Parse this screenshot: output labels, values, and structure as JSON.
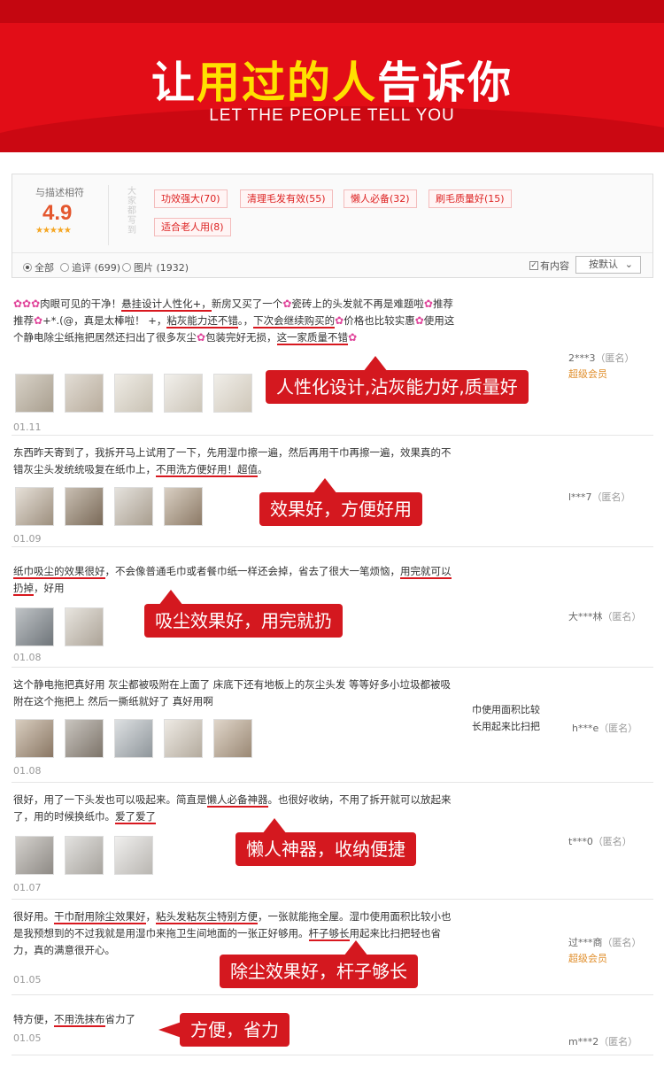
{
  "banner": {
    "title_pre": "让",
    "title_highlight": "用过的人",
    "title_post": "告诉你",
    "subtitle": "LET THE PEOPLE TELL YOU"
  },
  "summary": {
    "score_label": "与描述相符",
    "score": "4.9",
    "stars": "★★★★★",
    "impression_label": "大家都写到",
    "tags": [
      "功效强大(70)",
      "清理毛发有效(55)",
      "懒人必备(32)",
      "刷毛质量好(15)",
      "适合老人用(8)"
    ]
  },
  "filter": {
    "options": [
      "全部",
      "追评 (699)",
      "图片 (1932)"
    ],
    "selected": 0,
    "has_content_label": "有内容",
    "has_content_checked": true,
    "sort_label": "按默认"
  },
  "reviews": [
    {
      "date": "01.11",
      "user": "2***3",
      "anon": "（匿名）",
      "vip": "超级会员",
      "callout": "人性化设计,沾灰能力好,质量好"
    },
    {
      "date": "01.09",
      "user": "l***7",
      "anon": "（匿名）",
      "vip": "",
      "callout": "效果好，方便好用"
    },
    {
      "date": "01.08",
      "user": "大***林",
      "anon": "（匿名）",
      "vip": "",
      "callout": "吸尘效果好，用完就扔"
    },
    {
      "date": "01.08",
      "user": "h***e",
      "anon": "（匿名）",
      "vip": "",
      "callout": ""
    },
    {
      "date": "01.07",
      "user": "t***0",
      "anon": "（匿名）",
      "vip": "",
      "callout": "懒人神器，收纳便捷"
    },
    {
      "date": "01.05",
      "user": "过***商",
      "anon": "（匿名）",
      "vip": "超级会员",
      "callout": "除尘效果好，杆子够长"
    },
    {
      "date": "01.05",
      "user": "m***2",
      "anon": "（匿名）",
      "vip": "",
      "callout": "方便，省力"
    }
  ],
  "review_texts": {
    "r1": {
      "a": "肉眼可见的干净！",
      "b": "悬挂设计人性化+，",
      "c": "新房又买了一个",
      "d": "瓷砖上的头发就不再是难题啦",
      "e": "推荐推荐",
      "f": "+*.(@，真是太棒啦！ +，",
      "g": "粘灰能力还不错",
      "h": "。，",
      "i": "下次会继续购买的",
      "j": "价格也比较实惠",
      "k": "使用这个静电除尘纸拖把居然还扫出了很多灰尘",
      "l": "包装完好无损，",
      "m": "这一家质量不错"
    },
    "r2": {
      "a": "东西昨天寄到了，我拆开马上试用了一下，先用湿巾擦一遍，然后再用干巾再擦一遍，效果真的不错灰尘头发统统吸复在纸巾上，",
      "b": "不用洗方便好用！超值",
      "c": "。"
    },
    "r3": {
      "a": "纸巾吸尘的效果很好",
      "b": "，不会像普通毛巾或者餐巾纸一样还会掉，省去了很大一笔烦恼，",
      "c": "用完就可以扔掉",
      "d": "，好用"
    },
    "r4": {
      "a": "这个静电拖把真好用 灰尘都被吸附在上面了 床底下还有地板上的灰尘头发 等等好多小垃圾都被吸附在这个拖把上 然后一撕纸就好了 真好用啊"
    },
    "r4_side": {
      "a": "巾使用面积比较",
      "b": "长用起来比扫把"
    },
    "r5": {
      "a": "很好，用了一下头发也可以吸起来。简直是",
      "b": "懒人必备神器",
      "c": "。也很好收纳，不用了拆开就可以放起来了，用的时候换纸巾。",
      "d": "爱了爱了"
    },
    "r6": {
      "a": "很好用。",
      "b": "干巾耐用除尘效果好",
      "c": "，",
      "d": "粘头发粘灰尘特别方便",
      "e": "，一张就能拖全屋。湿巾使用面积比较小也是我预想到的不过我就是用湿巾来拖卫生间地面的一张正好够用。",
      "f": "杆子够长",
      "g": "用起来比扫把轻也省力，真的满意很开心。"
    },
    "r7": {
      "a": "特方便，",
      "b": "不用洗抹布",
      "c": "省力了"
    }
  },
  "colors": {
    "banner_red": "#e20d17",
    "callout_red": "#d4181f",
    "highlight_yellow": "#ffe000",
    "score_orange": "#e4572e",
    "vip_gold": "#e08e2b"
  }
}
